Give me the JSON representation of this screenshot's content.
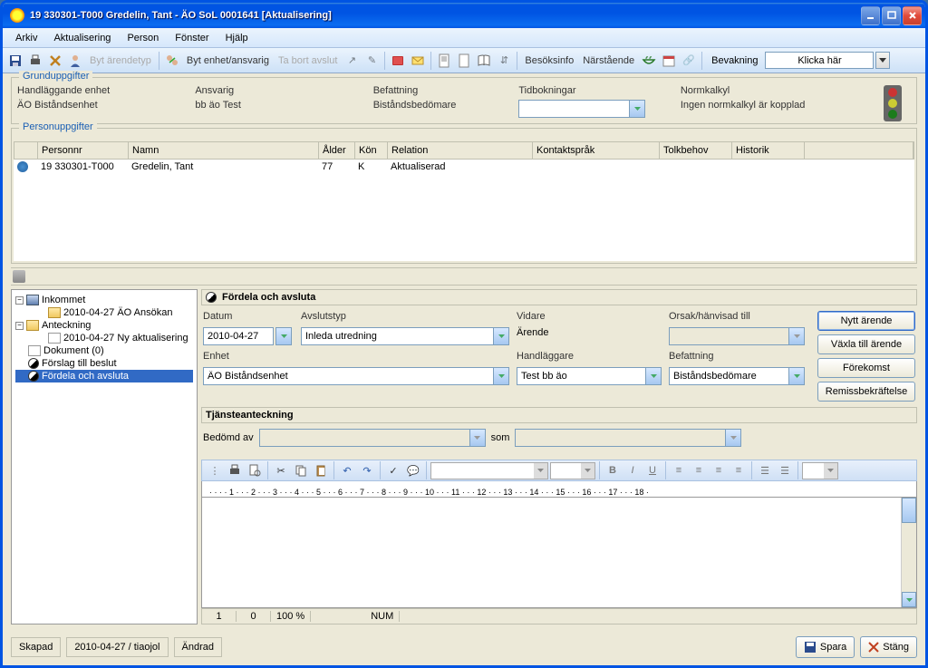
{
  "window_title": "19 330301-T000   Gredelin, Tant   -   ÄO SoL   0001641   [Aktualisering]",
  "menu": {
    "arkiv": "Arkiv",
    "aktualisering": "Aktualisering",
    "person": "Person",
    "fonster": "Fönster",
    "hjalp": "Hjälp"
  },
  "toolbar": {
    "byt_arendetyp": "Byt ärendetyp",
    "byt_enhet": "Byt enhet/ansvarig",
    "ta_bort": "Ta bort avslut",
    "besoksinfo": "Besöksinfo",
    "narsta": "Närstående",
    "bevakning": "Bevakning",
    "klicka": "Klicka här"
  },
  "grund": {
    "legend": "Grunduppgifter",
    "handl_enhet_lbl": "Handläggande enhet",
    "handl_enhet_val": "ÄO Biståndsenhet",
    "ansvarig_lbl": "Ansvarig",
    "ansvarig_val": "bb äo Test",
    "befattning_lbl": "Befattning",
    "befattning_val": "Biståndsbedömare",
    "tidbok_lbl": "Tidbokningar",
    "tidbok_val": "",
    "normkalkyl_lbl": "Normkalkyl",
    "normkalkyl_val": "Ingen normkalkyl är kopplad"
  },
  "person": {
    "legend": "Personuppgifter",
    "cols": {
      "personnr": "Personnr",
      "namn": "Namn",
      "alder": "Ålder",
      "kon": "Kön",
      "relation": "Relation",
      "kontaktsprak": "Kontaktspråk",
      "tolkbehov": "Tolkbehov",
      "historik": "Historik"
    },
    "row": {
      "personnr": "19 330301-T000",
      "namn": "Gredelin, Tant",
      "alder": "77",
      "kon": "K",
      "relation": "Aktualiserad"
    }
  },
  "tree": {
    "inkommet": "Inkommet",
    "inkommet_child": "2010-04-27 ÄO Ansökan",
    "anteckning": "Anteckning",
    "anteckning_child": "2010-04-27 Ny aktualisering",
    "dokument": "Dokument (0)",
    "forslag": "Förslag till beslut",
    "fordela": "Fördela och avsluta"
  },
  "section1": {
    "title": "Fördela och avsluta",
    "datum_lbl": "Datum",
    "datum_val": "2010-04-27",
    "avslutstyp_lbl": "Avslutstyp",
    "avslutstyp_val": "Inleda utredning",
    "vidare_lbl": "Vidare",
    "vidare_val": "Ärende",
    "orsak_lbl": "Orsak/hänvisad till",
    "orsak_val": "",
    "enhet_lbl": "Enhet",
    "enhet_val": "ÄO Biståndsenhet",
    "handlaggare_lbl": "Handläggare",
    "handlaggare_val": "Test bb äo",
    "befattning2_lbl": "Befattning",
    "befattning2_val": "Biståndsbedömare"
  },
  "buttons": {
    "nytt": "Nytt ärende",
    "vaxla": "Växla till ärende",
    "forekomst": "Förekomst",
    "remiss": "Remissbekräftelse"
  },
  "section2": {
    "title": "Tjänsteanteckning",
    "bedomd_lbl": "Bedömd av",
    "bedomd_val": "",
    "som_lbl": "som",
    "som_val": ""
  },
  "rte_status": {
    "page": "1",
    "line": "0",
    "zoom": "100 %",
    "num": "NUM"
  },
  "status": {
    "skapad": "Skapad",
    "datum": "2010-04-27 / tiaojol",
    "andrad": "Ändrad",
    "spara": "Spara",
    "stang": "Stäng"
  }
}
